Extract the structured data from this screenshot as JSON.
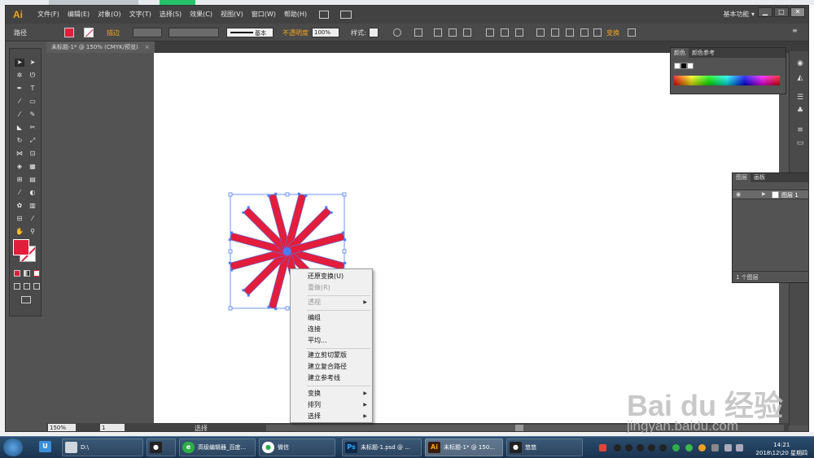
{
  "app": {
    "logo": "Ai",
    "menu": [
      "文件(F)",
      "编辑(E)",
      "对象(O)",
      "文字(T)",
      "选择(S)",
      "效果(C)",
      "视图(V)",
      "窗口(W)",
      "帮助(H)"
    ],
    "workspace": "基本功能",
    "win_buttons": [
      "▁",
      "□",
      "✕"
    ]
  },
  "control_bar": {
    "object_type": "路径",
    "stroke_label": "描边",
    "stroke_style": "基本",
    "opacity_label": "不透明度",
    "opacity_value": "100%",
    "style_label": "样式:",
    "transform_label": "变换"
  },
  "document": {
    "tab_title": "未标题-1* @ 150% (CMYK/预览)",
    "tab_close": "×"
  },
  "colors": {
    "fill": "#e21e3c",
    "selection": "#4a7bff"
  },
  "color_panel": {
    "tabs": [
      "颜色",
      "颜色参考"
    ]
  },
  "layers_panel": {
    "tabs": [
      "图层",
      "画板"
    ],
    "layer_name": "图层 1",
    "footer": "1 个图层"
  },
  "status_bar": {
    "zoom": "150%",
    "page": "1",
    "mode": "选择"
  },
  "context_menu": {
    "items": [
      {
        "label": "还原变换(U)",
        "enabled": true,
        "submenu": false
      },
      {
        "label": "重做(R)",
        "enabled": false,
        "submenu": false
      },
      {
        "label": "透视",
        "enabled": false,
        "submenu": true
      },
      {
        "label": "编组",
        "enabled": true,
        "submenu": false
      },
      {
        "label": "连接",
        "enabled": true,
        "submenu": false
      },
      {
        "label": "平均...",
        "enabled": true,
        "submenu": false
      },
      {
        "label": "建立剪切蒙版",
        "enabled": true,
        "submenu": false
      },
      {
        "label": "建立复合路径",
        "enabled": true,
        "submenu": false
      },
      {
        "label": "建立参考线",
        "enabled": true,
        "submenu": false
      },
      {
        "label": "变换",
        "enabled": true,
        "submenu": true
      },
      {
        "label": "排列",
        "enabled": true,
        "submenu": true
      },
      {
        "label": "选择",
        "enabled": true,
        "submenu": true
      }
    ]
  },
  "taskbar": {
    "items": [
      {
        "label": "D:\\",
        "icon": "drive-icon"
      },
      {
        "label": "",
        "icon": "qq-icon"
      },
      {
        "label": "高级编辑器_百度...",
        "icon": "browser-icon"
      },
      {
        "label": "微信",
        "icon": "wechat-icon"
      },
      {
        "label": "未标题-1.psd @ ...",
        "icon": "photoshop-icon"
      },
      {
        "label": "未标题-1* @ 150...",
        "icon": "illustrator-icon"
      },
      {
        "label": "悠悠",
        "icon": "qq-icon"
      }
    ],
    "time": "14:21",
    "date": "2018\\12\\20 星期四"
  },
  "watermark": {
    "brand": "Bai du 经验",
    "url": "jingyan.baidu.com"
  }
}
